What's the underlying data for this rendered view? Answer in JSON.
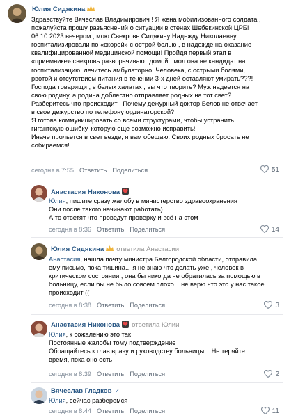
{
  "comments": [
    {
      "author": "Юлия Сидякина",
      "badge": "crown-icon",
      "reply_to": "",
      "text": [
        "Здравствуйте Вячеслав Владимирович ! Я жена мобилизованного солдата ,",
        "пожалуйста прошу разъяснений о ситуации в стенах Шебекинской ЦРБ!",
        "06.10.2023 вечером , мою Свекровь Сидякину Надежду Николаевну",
        "госпитализировали по «скорой» с острой болью , в надежде на оказание",
        "квалифицированной медицинской помощи! Пройдя первый этап в",
        "«приемнике» свекровь разворачивают домой , мол она не кандидат на",
        "госпитализацию, лечитесь амбулаторно! Человека, с острыми болями,",
        "рвотой и отсутствием питания в течении 3-х дней оставляют умирать???!",
        "Господа товарищи , в белых халатах , вы что творите? Муж надеется на",
        "свою родину, а родина доблестно отправляет родных на тот свет?",
        "Разберитесь что происходит ! Почему дежурный доктор Белов не отвечает",
        "в свое дежурство по телефону ординаторской?",
        "Я готова коммуницировать со всеми структурами, чтобы устранить",
        "гигантскую ошибку, которую еще возможно исправить!",
        "Иначе прольется в свет везде, я вам обещаю. Своих родных бросать не",
        "собираемся!"
      ],
      "time": "сегодня в 7:55",
      "reply_label": "Ответить",
      "share_label": "Поделиться",
      "likes": "51"
    },
    {
      "author": "Анастасия Никонова",
      "badge": "heart-badge-icon",
      "reply_to": "",
      "mention": "Юлия",
      "text": [
        ", пишите сразу жалобу в министерство здравоохранения",
        "Они после такого начинают работать)",
        "А то ответят что проведут проверку и всё на этом"
      ],
      "time": "сегодня в 8:36",
      "reply_label": "Ответить",
      "share_label": "Поделиться",
      "likes": "14"
    },
    {
      "author": "Юлия Сидякина",
      "badge": "crown-icon",
      "reply_to": "ответила Анастасии",
      "mention": "Анастасия",
      "text": [
        ", нашла почту министра Белгородской области, отправила",
        "ему письмо, пока тишина... я не знаю что делать уже , человек в",
        "критическом состоянии , она бы никогда не обратилась за помощью в",
        "больницу, если бы не было совсем плохо... не верю что это у нас такое",
        "происходит (("
      ],
      "time": "сегодня в 8:38",
      "reply_label": "Ответить",
      "share_label": "Поделиться",
      "likes": "3"
    },
    {
      "author": "Анастасия Никонова",
      "badge": "heart-badge-icon",
      "reply_to": "ответила Юлии",
      "mention": "Юлия",
      "text": [
        ", к сожалению это так",
        "Постоянные жалобы тому подтверждение",
        "Обращайтесь к глав врачу и руководству больницы... Не теряйте",
        "время, пока оно есть"
      ],
      "time": "сегодня в 8:39",
      "reply_label": "Ответить",
      "share_label": "Поделиться",
      "likes": "2"
    },
    {
      "author": "Вячеслав Гладков",
      "badge": "verified-check-icon",
      "reply_to": "",
      "mention": "Юлия",
      "text": [
        ", сейчас разберемся"
      ],
      "time": "сегодня в 8:44",
      "reply_label": "Ответить",
      "share_label": "Поделиться",
      "likes": "11"
    }
  ],
  "colors": {
    "author": "#2a5885",
    "meta": "#818c99",
    "divider": "#e7e8ec",
    "badge_heart": "#e64646",
    "badge_crown": "#f0b53d",
    "check": "#4a76a8"
  }
}
